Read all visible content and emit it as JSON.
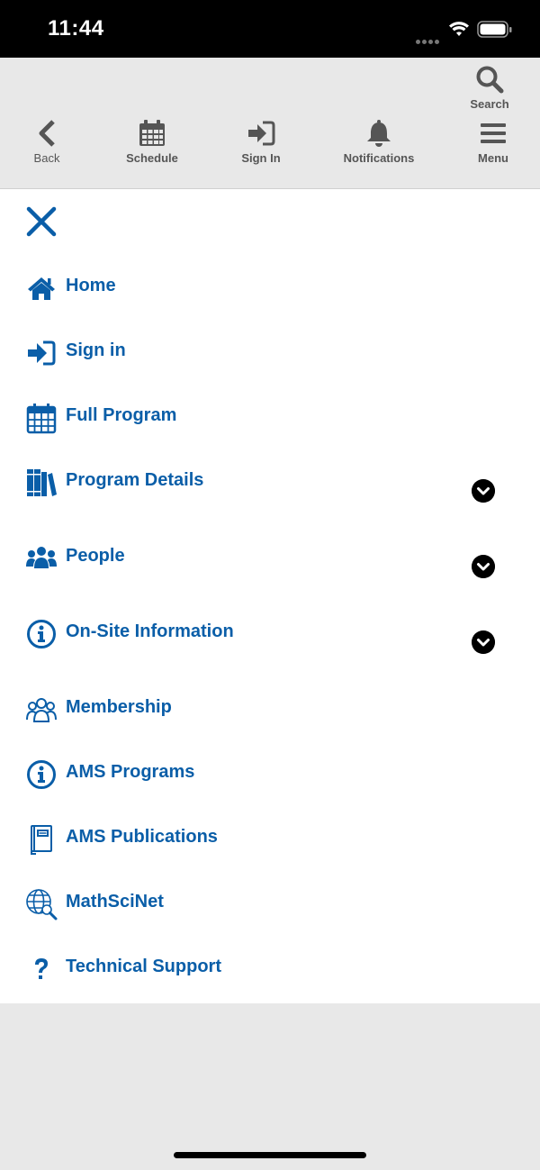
{
  "status": {
    "time": "11:44"
  },
  "toolbar": {
    "search": "Search",
    "back": "Back",
    "schedule": "Schedule",
    "sign_in": "Sign In",
    "notifications": "Notifications",
    "menu": "Menu"
  },
  "menu": {
    "items": [
      {
        "label": "Home",
        "icon": "home-icon"
      },
      {
        "label": "Sign in",
        "icon": "sign-in-icon"
      },
      {
        "label": "Full Program",
        "icon": "calendar-icon"
      },
      {
        "label": "Program Details",
        "icon": "books-icon",
        "expandable": true
      },
      {
        "label": "People",
        "icon": "people-icon",
        "expandable": true
      },
      {
        "label": "On-Site Information",
        "icon": "info-icon",
        "expandable": true
      },
      {
        "label": "Membership",
        "icon": "membership-icon"
      },
      {
        "label": "AMS Programs",
        "icon": "info-icon"
      },
      {
        "label": "AMS Publications",
        "icon": "book-icon"
      },
      {
        "label": "MathSciNet",
        "icon": "globe-search-icon"
      },
      {
        "label": "Technical Support",
        "icon": "question-icon"
      }
    ]
  },
  "colors": {
    "accent": "#0a5ea8",
    "toolbar_bg": "#e8e8e8",
    "icon_gray": "#555555"
  }
}
